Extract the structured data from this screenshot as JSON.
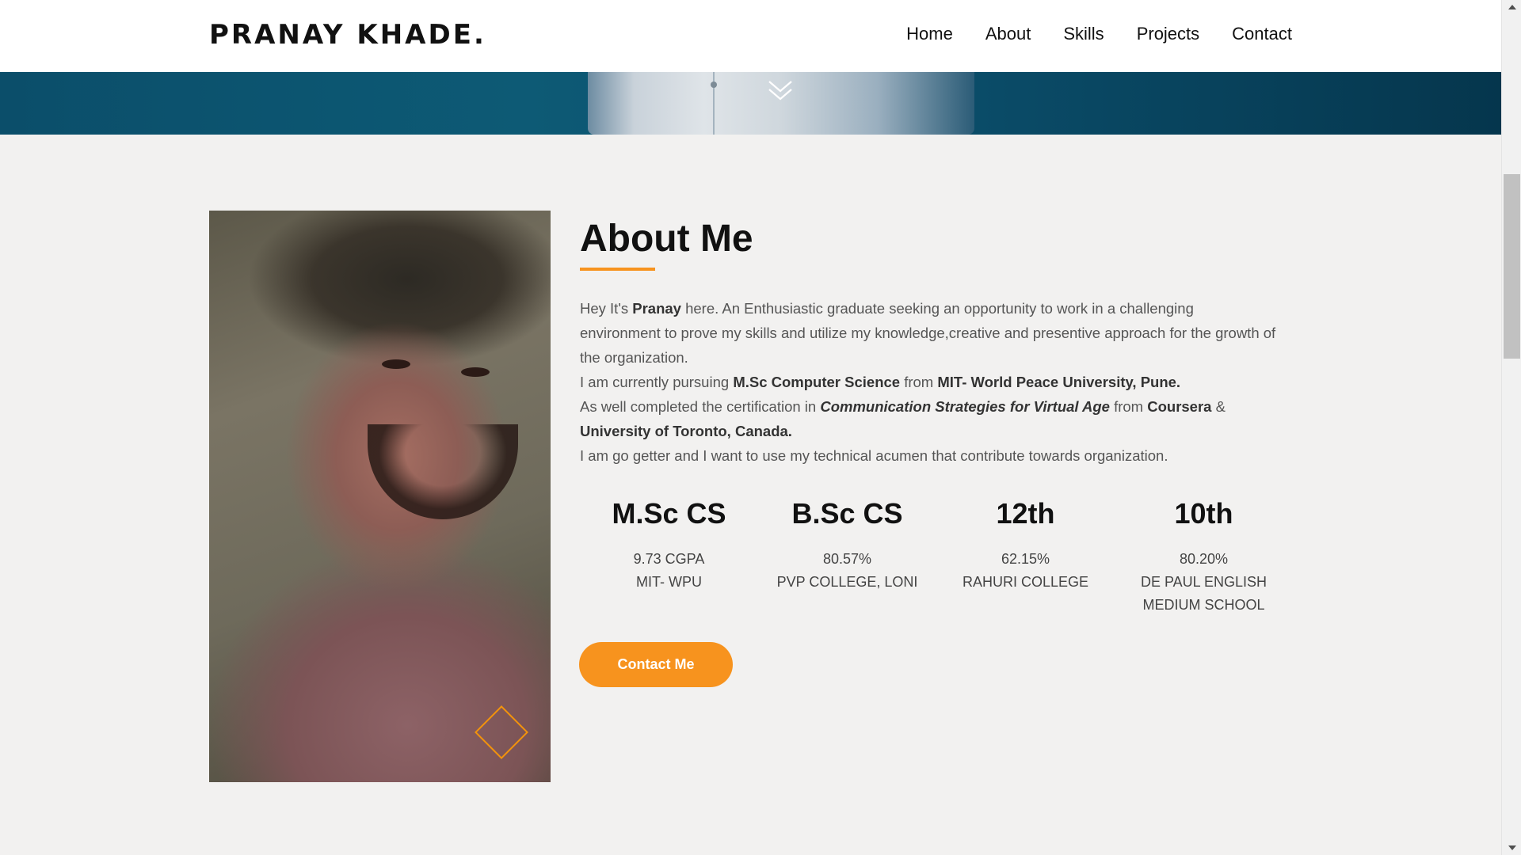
{
  "brand": {
    "name": "PRANAY KHADE."
  },
  "nav": {
    "items": [
      "Home",
      "About",
      "Skills",
      "Projects",
      "Contact"
    ]
  },
  "about": {
    "title": "About Me",
    "bio": {
      "l1_pre": "Hey It's ",
      "l1_name": "Pranay",
      "l1_post": " here. An Enthusiastic graduate seeking an opportunity to work in a challenging environment to prove my skills and utilize my knowledge,creative and presentive approach for the growth of the organization.",
      "l2_pre": "I am currently pursuing ",
      "l2_degree": "M.Sc Computer Science",
      "l2_mid": " from ",
      "l2_univ": "MIT- World Peace University, Pune.",
      "l3_pre": "As well completed the certification in ",
      "l3_course": "Communication Strategies for Virtual Age",
      "l3_mid": " from ",
      "l3_provider": "Coursera",
      "l3_amp": " & ",
      "l3_univ": "University of Toronto, Canada.",
      "l4": "I am go getter and I want to use my technical acumen that contribute towards organization."
    },
    "stats": [
      {
        "title": "M.Sc CS",
        "score": "9.73 CGPA",
        "institute": "MIT- WPU"
      },
      {
        "title": "B.Sc CS",
        "score": "80.57%",
        "institute": "PVP COLLEGE, LONI"
      },
      {
        "title": "12th",
        "score": "62.15%",
        "institute": "RAHURI COLLEGE"
      },
      {
        "title": "10th",
        "score": "80.20%",
        "institute": "DE PAUL ENGLISH MEDIUM SCHOOL"
      }
    ],
    "contact_button": "Contact Me"
  },
  "colors": {
    "accent": "#f7931e",
    "hero": "#0b4e6a",
    "background": "#f2f1f0"
  },
  "icons": {
    "scroll_down": "chevron-double-down-icon",
    "decor": "diamond-outline-icon"
  }
}
